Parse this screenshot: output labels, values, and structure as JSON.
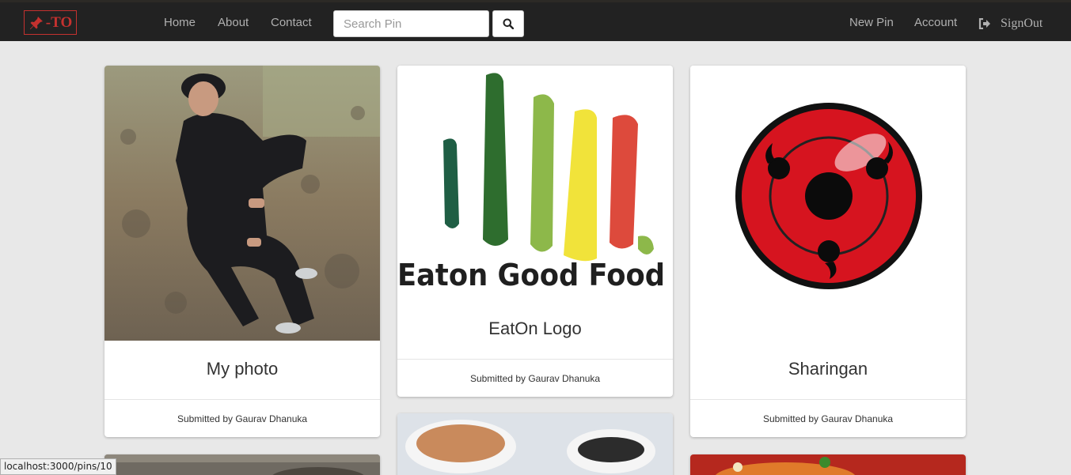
{
  "nav": {
    "brand_text": "-TO",
    "links": [
      "Home",
      "About",
      "Contact"
    ],
    "search_placeholder": "Search Pin",
    "right_links": [
      "New Pin",
      "Account"
    ],
    "signout_label": "SignOut"
  },
  "pins": [
    {
      "title": "My photo",
      "submitted": "Submitted by Gaurav Dhanuka"
    },
    {
      "title": "EatOn Logo",
      "submitted": "Submitted by Gaurav Dhanuka",
      "image_text": "Eaton Good Food"
    },
    {
      "title": "Sharingan",
      "submitted": "Submitted by Gaurav Dhanuka"
    }
  ],
  "status_url": "localhost:3000/pins/10",
  "colors": {
    "navbar": "#222222",
    "brand": "#c4312f",
    "page_bg": "#e8e8e8"
  }
}
